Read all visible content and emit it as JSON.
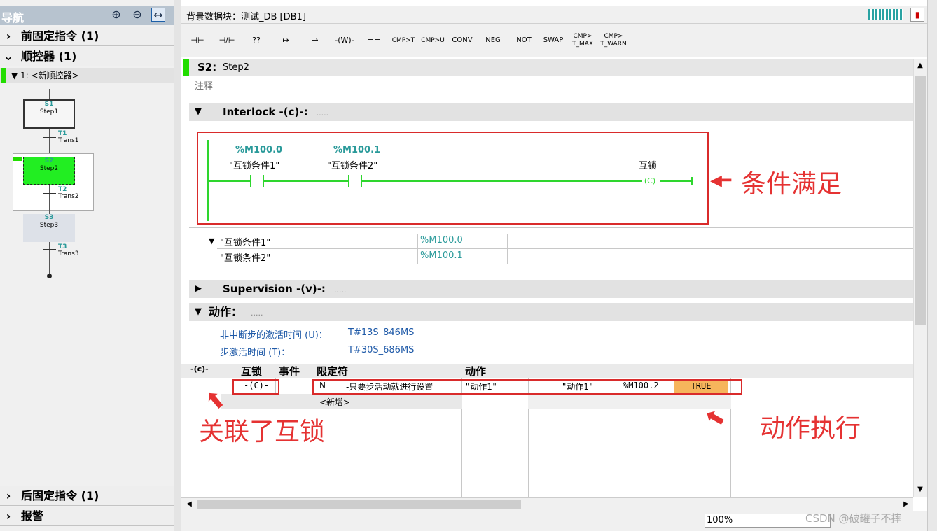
{
  "nav": {
    "title": "导航",
    "tools": [
      "zoom-in-icon",
      "zoom-out-icon",
      "fit-width-icon"
    ],
    "rows": [
      {
        "arrow": "›",
        "label": "前固定指令 (1)"
      },
      {
        "arrow": "⌄",
        "label": "顺控器 (1)"
      },
      {
        "arrow": "›",
        "label": "后固定指令 (1)"
      },
      {
        "arrow": "›",
        "label": "报警"
      }
    ],
    "sequencer": "▼ 1: <新顺控器>",
    "graph": {
      "steps": [
        {
          "num": "S1",
          "name": "Step1"
        },
        {
          "num": "S2",
          "name": "Step2"
        },
        {
          "num": "S3",
          "name": "Step3"
        }
      ],
      "transitions": [
        {
          "num": "T1",
          "name": "Trans1"
        },
        {
          "num": "T2",
          "name": "Trans2"
        },
        {
          "num": "T3",
          "name": "Trans3"
        }
      ]
    }
  },
  "header": {
    "db_title": "背景数据块：测试_DB [DB1]"
  },
  "toolbar": {
    "buttons": [
      "⊣⊢",
      "⊣/⊢",
      "??",
      "↦",
      "⇀",
      "-(W)-",
      "==",
      "CMP>T",
      "CMP>U",
      "CONV",
      "NEG",
      "NOT",
      "SWAP",
      "CMP> T_MAX",
      "CMP> T_WARN"
    ]
  },
  "step": {
    "id": "S2:",
    "name": "Step2",
    "comment": "注释"
  },
  "interlock": {
    "title": "Interlock -(c)-:",
    "dots": ".....",
    "contacts": [
      {
        "address": "%M100.0",
        "tag": "\"互锁条件1\""
      },
      {
        "address": "%M100.1",
        "tag": "\"互锁条件2\""
      }
    ],
    "coil_label": "互锁",
    "coil": "C",
    "annotation": "条件满足",
    "table": [
      {
        "tag": "\"互锁条件1\"",
        "address": "%M100.0"
      },
      {
        "tag": "\"互锁条件2\"",
        "address": "%M100.1"
      }
    ]
  },
  "supervision": {
    "title": "Supervision -(v)-:",
    "dots": "....."
  },
  "actions": {
    "title": "动作：",
    "dots": ".....",
    "activation_time_label": "非中断步的激活时间 (U)：",
    "activation_time_value": "T#13S_846MS",
    "step_time_label": "步激活时间 (T)：",
    "step_time_value": "T#30S_686MS",
    "side_icon": "-(c)-",
    "columns": [
      "互锁",
      "事件",
      "限定符",
      "动作"
    ],
    "row": {
      "interlock": "-(C)-",
      "qualifier": "N",
      "qualifier_desc": "-只要步活动就进行设置",
      "action": "\"动作1\"",
      "action2": "\"动作1\"",
      "address": "%M100.2",
      "value": "TRUE"
    },
    "add_label": "<新增>",
    "annotation_interlock": "关联了互锁",
    "annotation_exec": "动作执行"
  },
  "status": {
    "zoom": "100%",
    "watermark": "CSDN @破罐子不摔"
  },
  "colors": {
    "green": "#2ed62e",
    "red": "#e53232",
    "true_bg": "#f6b55c",
    "teal": "#2a9a9a"
  }
}
